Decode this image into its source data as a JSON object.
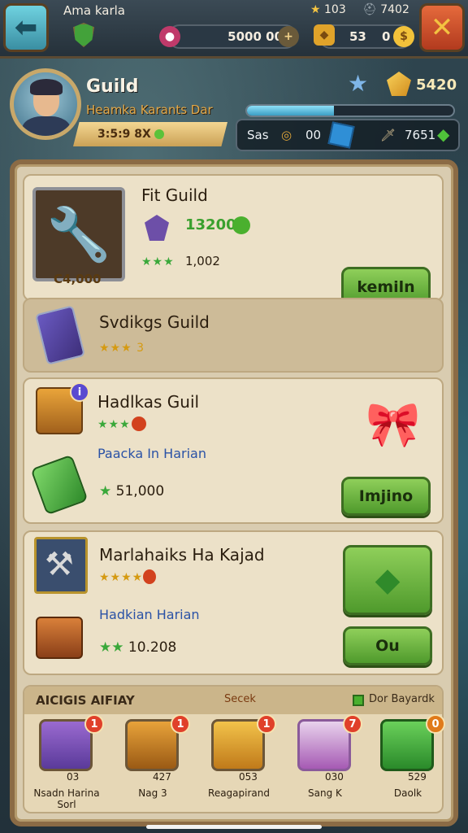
{
  "top_bar": {
    "player_name": "Ama karla",
    "stat_a": "103",
    "stat_b": "7402",
    "potion_amount": "5000 00",
    "shield_amount": "53",
    "coin_amount": "0",
    "back_icon": "arrow-left-icon",
    "close_icon": "x-icon"
  },
  "profile": {
    "title": "Guild",
    "subtitle": "Heamka Karants Dar",
    "level_text": "3:5:9 8X",
    "gold": "5420",
    "xp_percent": 42,
    "strip_label": "Sas",
    "strip_amount_a": "00",
    "strip_amount_b": "7651"
  },
  "cards": [
    {
      "title": "Fit Guild",
      "reward": "13200",
      "stars": "★★★",
      "count": "1,002",
      "item_price": "C4,000",
      "button": "kemiln"
    },
    {
      "title": "Svdikgs Guild",
      "stars": "★★★",
      "stars_suffix": "3"
    },
    {
      "title": "Hadlkas Guil",
      "stars": "★★★",
      "subtitle": "Paacka In Harian",
      "amount": "51,000",
      "button": "Imjino"
    },
    {
      "title": "Marlahaiks Ha Kajad",
      "stars": "★★★★",
      "subtitle": "Hadkian Harian",
      "amount": "10.208",
      "button": "Ou"
    }
  ],
  "shelf": {
    "heading": "AICIGIS AIFIAY",
    "mid_label": "Secek",
    "right_label": "Dor Bayardk",
    "items": [
      {
        "caption": "Nsadn Harina Sorl",
        "count": "03",
        "badge": "1"
      },
      {
        "caption": "Nag 3",
        "count": "427",
        "badge": "1"
      },
      {
        "caption": "Reagapirand",
        "count": "053",
        "badge": "1"
      },
      {
        "caption": "Sang K",
        "count": "030",
        "badge": "7"
      },
      {
        "caption": "Daolk",
        "count": "529",
        "badge": "0"
      }
    ]
  },
  "colors": {
    "panel": "#d9ccb0",
    "button_green": "#6fb640",
    "accent_gold": "#e2a94a",
    "badge_red": "#e0402a"
  }
}
